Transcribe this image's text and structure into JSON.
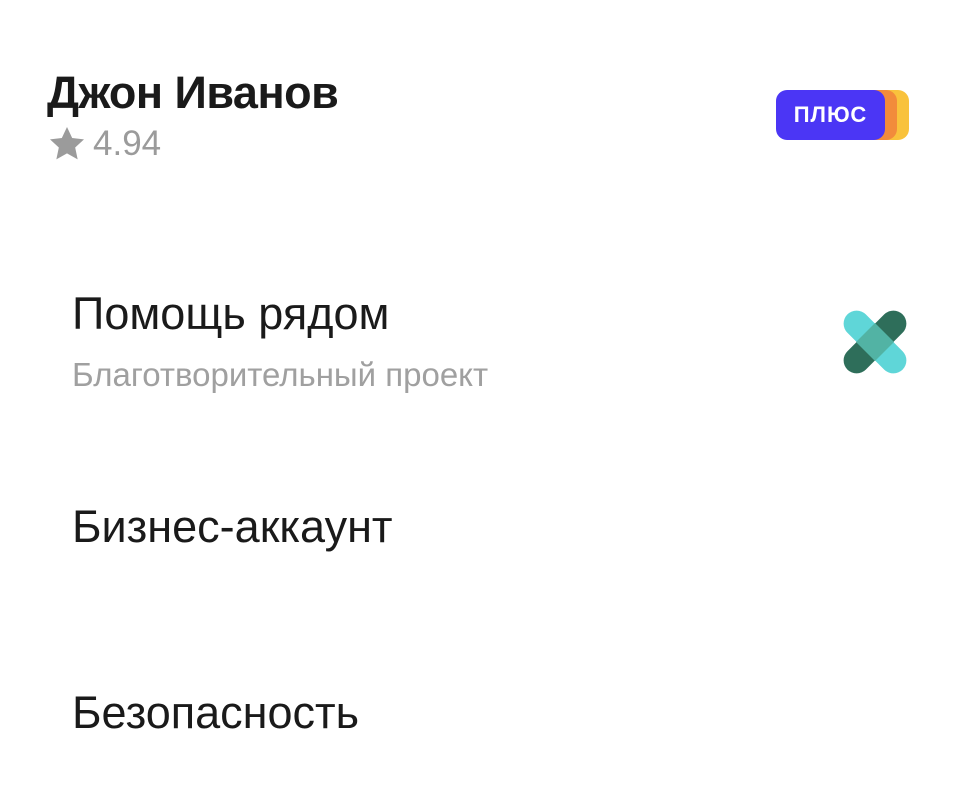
{
  "profile": {
    "name": "Джон Иванов",
    "rating": "4.94",
    "rating_icon": "star-icon"
  },
  "plus_badge": {
    "label": "ПЛЮС",
    "colors": {
      "main": "#4b36f5",
      "second": "#f28b3b",
      "third": "#f9c23c"
    }
  },
  "menu": {
    "items": [
      {
        "title": "Помощь рядом",
        "subtitle": "Благотворительный проект",
        "icon": "help-nearby-logo-icon"
      },
      {
        "title": "Бизнес-аккаунт"
      },
      {
        "title": "Безопасность"
      }
    ]
  },
  "colors": {
    "text_primary": "#1a1a1a",
    "text_secondary": "#9b9b9b",
    "help_logo_light": "#5fd6d8",
    "help_logo_mid": "#52b3a4",
    "help_logo_dark": "#2e6e5a"
  }
}
